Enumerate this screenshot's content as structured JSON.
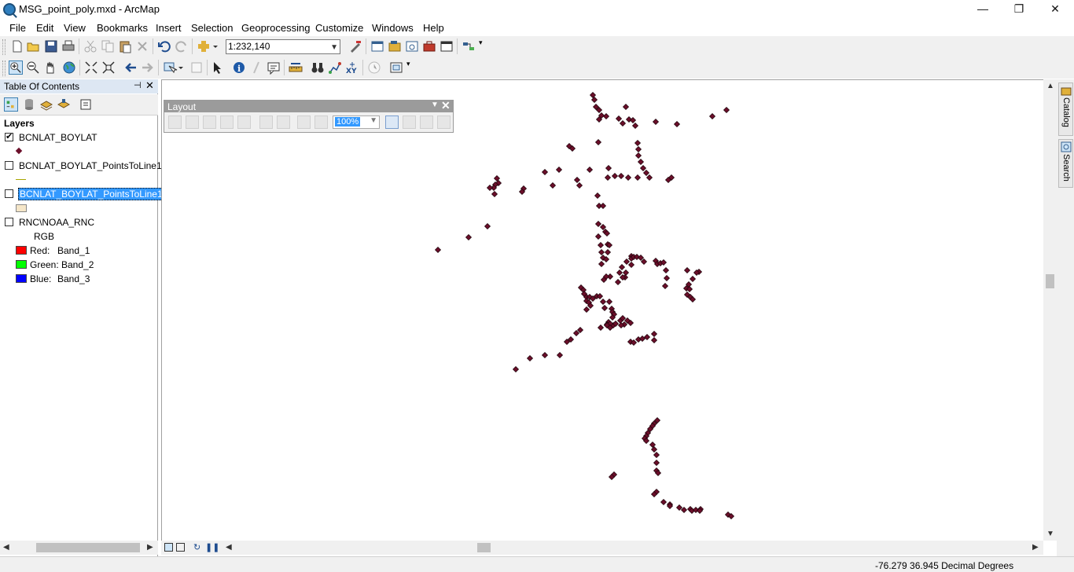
{
  "window": {
    "title": "MSG_point_poly.mxd - ArcMap",
    "minimize": "—",
    "restore": "❐",
    "close": "✕"
  },
  "menu": [
    "File",
    "Edit",
    "View",
    "Bookmarks",
    "Insert",
    "Selection",
    "Geoprocessing",
    "Customize",
    "Windows",
    "Help"
  ],
  "toolbar": {
    "scale_value": "1:232,140"
  },
  "toc": {
    "title": "Table Of Contents",
    "pin": "⊣",
    "close": "✕",
    "group_label": "Layers",
    "layers": [
      {
        "name": "BCNLAT_BOYLAT",
        "checked": true
      },
      {
        "name": "BCNLAT_BOYLAT_PointsToLine1",
        "checked": false
      },
      {
        "name": "BCNLAT_BOYLAT_PointsToLine1",
        "checked": false
      },
      {
        "name": "RNC\\NOAA_RNC",
        "checked": false
      }
    ],
    "raster": {
      "rgb_label": "RGB",
      "bands": [
        {
          "label": "Red:",
          "band": "Band_1",
          "color": "#ff0000"
        },
        {
          "label": "Green:",
          "band": "Band_2",
          "color": "#00ff00"
        },
        {
          "label": "Blue:",
          "band": "Band_3",
          "color": "#0000ff"
        }
      ]
    }
  },
  "layout_toolbar": {
    "title": "Layout",
    "menu": "▼",
    "close": "✕",
    "zoom_value": "100%"
  },
  "right_dock": {
    "tabs": [
      "Catalog",
      "Search"
    ]
  },
  "status": {
    "coordinates": "-76.279  36.945 Decimal Degrees"
  },
  "colors": {
    "point_fill": "#6b0f2a",
    "selection": "#3399ff"
  }
}
